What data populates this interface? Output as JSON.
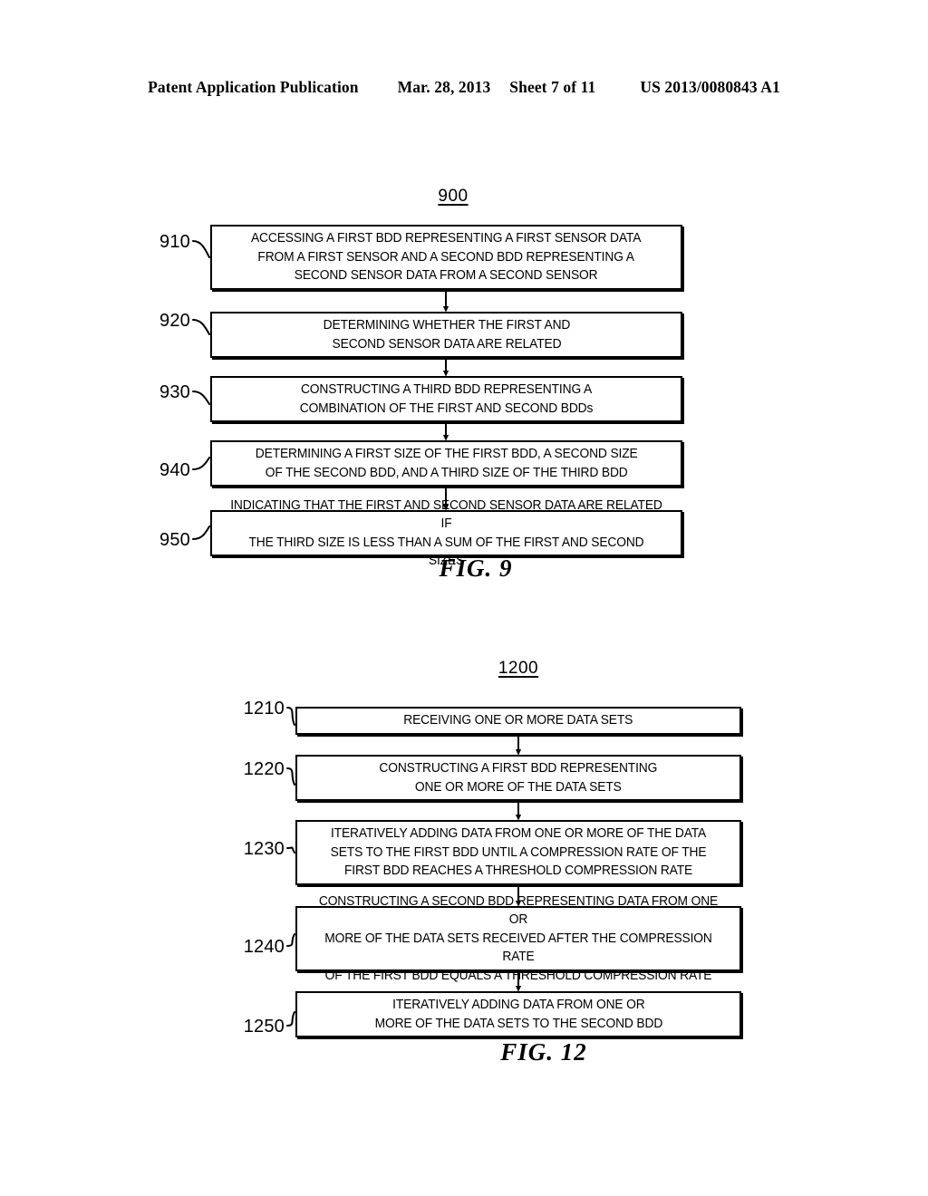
{
  "header": {
    "publication": "Patent Application Publication",
    "date": "Mar. 28, 2013",
    "sheet": "Sheet 7 of 11",
    "docnumber": "US 2013/0080843 A1"
  },
  "figures": [
    {
      "id": "fig9",
      "fig_number": "900",
      "caption": "FIG. 9",
      "steps": [
        {
          "ref": "910",
          "text": "ACCESSING A FIRST BDD REPRESENTING A FIRST SENSOR DATA\nFROM A FIRST SENSOR AND A SECOND BDD REPRESENTING A\nSECOND SENSOR DATA FROM A SECOND SENSOR"
        },
        {
          "ref": "920",
          "text": "DETERMINING WHETHER THE FIRST AND\nSECOND SENSOR DATA ARE RELATED"
        },
        {
          "ref": "930",
          "text": "CONSTRUCTING A THIRD BDD REPRESENTING A\nCOMBINATION OF THE FIRST AND SECOND BDDs"
        },
        {
          "ref": "940",
          "text": "DETERMINING A FIRST SIZE OF THE FIRST BDD, A SECOND SIZE\nOF THE SECOND BDD, AND A THIRD SIZE OF THE THIRD BDD"
        },
        {
          "ref": "950",
          "text": "INDICATING THAT THE FIRST AND SECOND SENSOR DATA ARE RELATED IF\nTHE THIRD SIZE IS LESS THAN A SUM OF THE FIRST AND SECOND SIZES"
        }
      ]
    },
    {
      "id": "fig12",
      "fig_number": "1200",
      "caption": "FIG. 12",
      "steps": [
        {
          "ref": "1210",
          "text": "RECEIVING ONE OR MORE DATA SETS"
        },
        {
          "ref": "1220",
          "text": "CONSTRUCTING A FIRST BDD REPRESENTING\nONE OR MORE OF THE DATA SETS"
        },
        {
          "ref": "1230",
          "text": "ITERATIVELY ADDING DATA FROM ONE OR MORE OF THE DATA\nSETS TO THE FIRST BDD UNTIL A COMPRESSION RATE OF THE\nFIRST BDD REACHES A THRESHOLD COMPRESSION RATE"
        },
        {
          "ref": "1240",
          "text": "CONSTRUCTING A SECOND BDD REPRESENTING DATA FROM ONE OR\nMORE OF THE DATA SETS RECEIVED AFTER THE COMPRESSION RATE\nOF THE FIRST BDD EQUALS A THRESHOLD COMPRESSION RATE"
        },
        {
          "ref": "1250",
          "text": "ITERATIVELY ADDING DATA FROM ONE OR\nMORE OF THE DATA SETS TO THE SECOND BDD"
        }
      ]
    }
  ],
  "colors": {
    "ink": "#000000",
    "paper": "#ffffff"
  }
}
